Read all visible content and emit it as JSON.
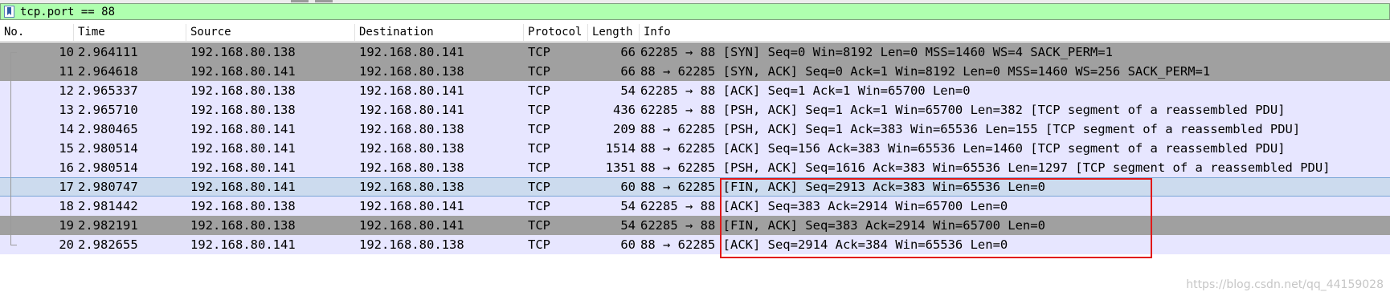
{
  "filter": {
    "value": "tcp.port == 88"
  },
  "columns": [
    "No.",
    "Time",
    "Source",
    "Destination",
    "Protocol",
    "Length",
    "Info"
  ],
  "rows": [
    {
      "no": "10",
      "time": "2.964111",
      "src": "192.168.80.138",
      "dst": "192.168.80.141",
      "proto": "TCP",
      "len": "66",
      "info": "62285 → 88 [SYN] Seq=0 Win=8192 Len=0 MSS=1460 WS=4 SACK_PERM=1",
      "color": "gray"
    },
    {
      "no": "11",
      "time": "2.964618",
      "src": "192.168.80.141",
      "dst": "192.168.80.138",
      "proto": "TCP",
      "len": "66",
      "info": "88 → 62285 [SYN, ACK] Seq=0 Ack=1 Win=8192 Len=0 MSS=1460 WS=256 SACK_PERM=1",
      "color": "gray"
    },
    {
      "no": "12",
      "time": "2.965337",
      "src": "192.168.80.138",
      "dst": "192.168.80.141",
      "proto": "TCP",
      "len": "54",
      "info": "62285 → 88 [ACK] Seq=1 Ack=1 Win=65700 Len=0",
      "color": "lav"
    },
    {
      "no": "13",
      "time": "2.965710",
      "src": "192.168.80.138",
      "dst": "192.168.80.141",
      "proto": "TCP",
      "len": "436",
      "info": "62285 → 88 [PSH, ACK] Seq=1 Ack=1 Win=65700 Len=382 [TCP segment of a reassembled PDU]",
      "color": "lav"
    },
    {
      "no": "14",
      "time": "2.980465",
      "src": "192.168.80.141",
      "dst": "192.168.80.138",
      "proto": "TCP",
      "len": "209",
      "info": "88 → 62285 [PSH, ACK] Seq=1 Ack=383 Win=65536 Len=155 [TCP segment of a reassembled PDU]",
      "color": "lav"
    },
    {
      "no": "15",
      "time": "2.980514",
      "src": "192.168.80.141",
      "dst": "192.168.80.138",
      "proto": "TCP",
      "len": "1514",
      "info": "88 → 62285 [ACK] Seq=156 Ack=383 Win=65536 Len=1460 [TCP segment of a reassembled PDU]",
      "color": "lav"
    },
    {
      "no": "16",
      "time": "2.980514",
      "src": "192.168.80.141",
      "dst": "192.168.80.138",
      "proto": "TCP",
      "len": "1351",
      "info": "88 → 62285 [PSH, ACK] Seq=1616 Ack=383 Win=65536 Len=1297 [TCP segment of a reassembled PDU]",
      "color": "lav"
    },
    {
      "no": "17",
      "time": "2.980747",
      "src": "192.168.80.141",
      "dst": "192.168.80.138",
      "proto": "TCP",
      "len": "60",
      "info": "88 → 62285 [FIN, ACK] Seq=2913 Ack=383 Win=65536 Len=0",
      "color": "sel"
    },
    {
      "no": "18",
      "time": "2.981442",
      "src": "192.168.80.138",
      "dst": "192.168.80.141",
      "proto": "TCP",
      "len": "54",
      "info": "62285 → 88 [ACK] Seq=383 Ack=2914 Win=65700 Len=0",
      "color": "lav"
    },
    {
      "no": "19",
      "time": "2.982191",
      "src": "192.168.80.138",
      "dst": "192.168.80.141",
      "proto": "TCP",
      "len": "54",
      "info": "62285 → 88 [FIN, ACK] Seq=383 Ack=2914 Win=65700 Len=0",
      "color": "gray"
    },
    {
      "no": "20",
      "time": "2.982655",
      "src": "192.168.80.141",
      "dst": "192.168.80.138",
      "proto": "TCP",
      "len": "60",
      "info": "88 → 62285 [ACK] Seq=2914 Ack=384 Win=65536 Len=0",
      "color": "lav"
    }
  ],
  "watermark": "https://blog.csdn.net/qq_44159028",
  "colors": {
    "filter_bg": "#afffaf",
    "row_gray": "#a0a0a0",
    "row_lavender": "#e7e6ff",
    "row_selected": "#ccdbee",
    "highlight_box": "#e11919"
  }
}
